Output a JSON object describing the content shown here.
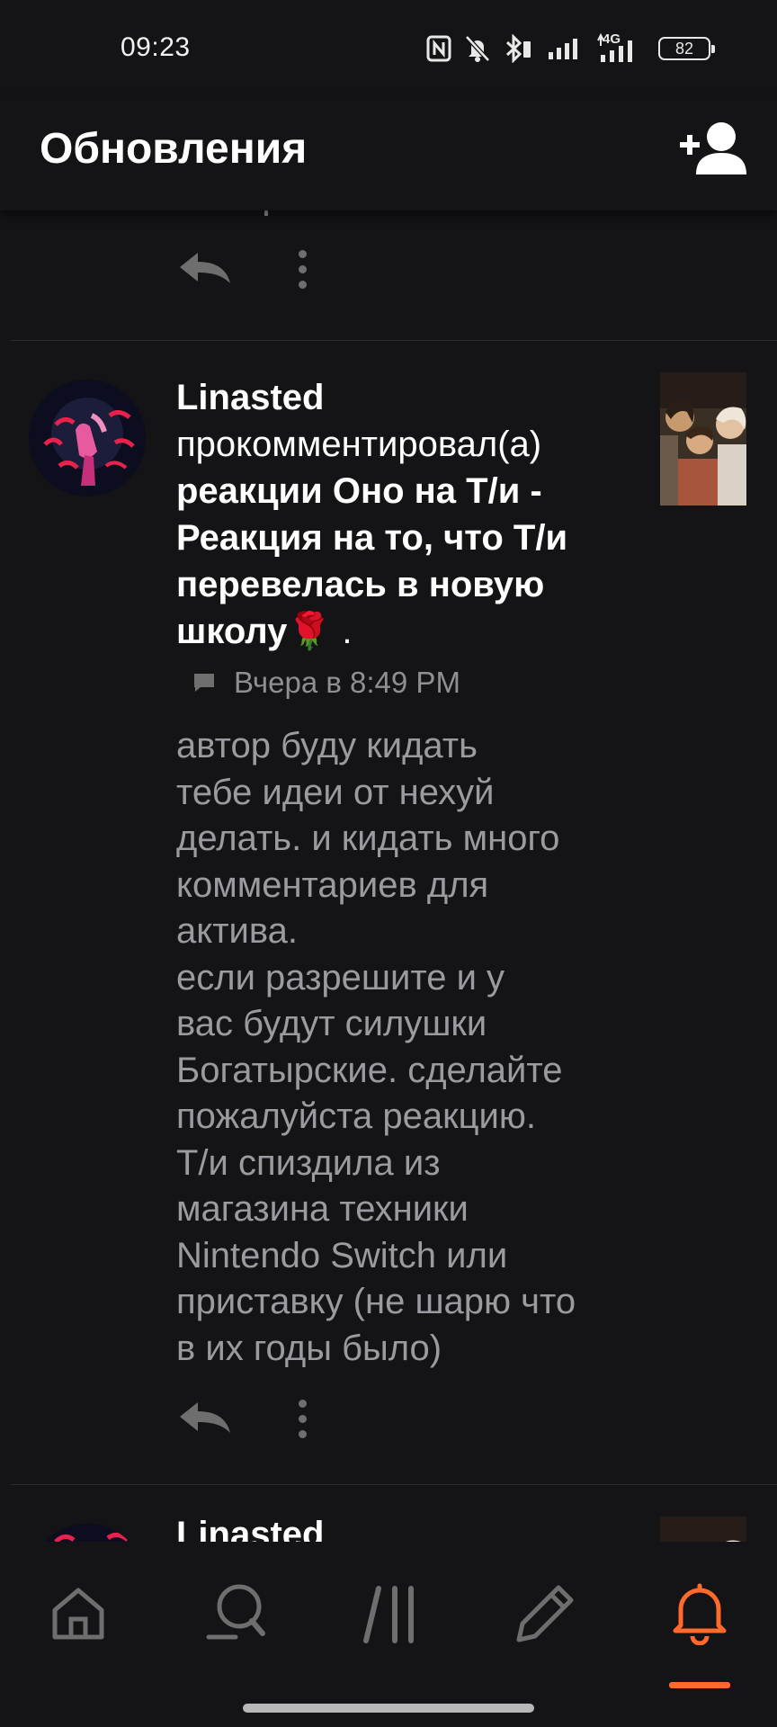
{
  "status_bar": {
    "time": "09:23",
    "network_label": "4G",
    "battery": "82",
    "icons": [
      "nfc-icon",
      "bell-muted-icon",
      "bluetooth-icon",
      "signal-icon",
      "signal-4g-icon",
      "battery-icon"
    ]
  },
  "header": {
    "title": "Обновления",
    "action_icon": "add-user-icon"
  },
  "notification": {
    "user": "Linasted",
    "action": "прокомментировал(а)",
    "target": "реакции Оно на Т/и - Реакция на то, что Т/и перевелась в новую школу",
    "emoji": "🌹",
    "suffix": " .",
    "time": "Вчера в 8:49 PM",
    "comment": "автор буду кидать\nтебе идеи от нехуй\nделать. и кидать много\nкомментариев для\nактива.\nесли разрешите и у\nвас будут силушки\nБогатырские. сделайте\nпожалуйста реакцию.\nТ/и спиздила из\nмагазина техники\nNintendo Switch или\nприставку (не шарю что\nв их годы было)"
  },
  "next_notification": {
    "user": "Linasted"
  },
  "bottom_nav": {
    "items": [
      "home-icon",
      "search-icon",
      "library-icon",
      "write-icon",
      "notifications-icon"
    ],
    "active": "notifications-icon"
  },
  "colors": {
    "background": "#141316",
    "accent": "#ff6a2c",
    "text_primary": "#ffffff",
    "text_secondary": "#9a9aa0",
    "icon_muted": "#6e6e6e"
  }
}
